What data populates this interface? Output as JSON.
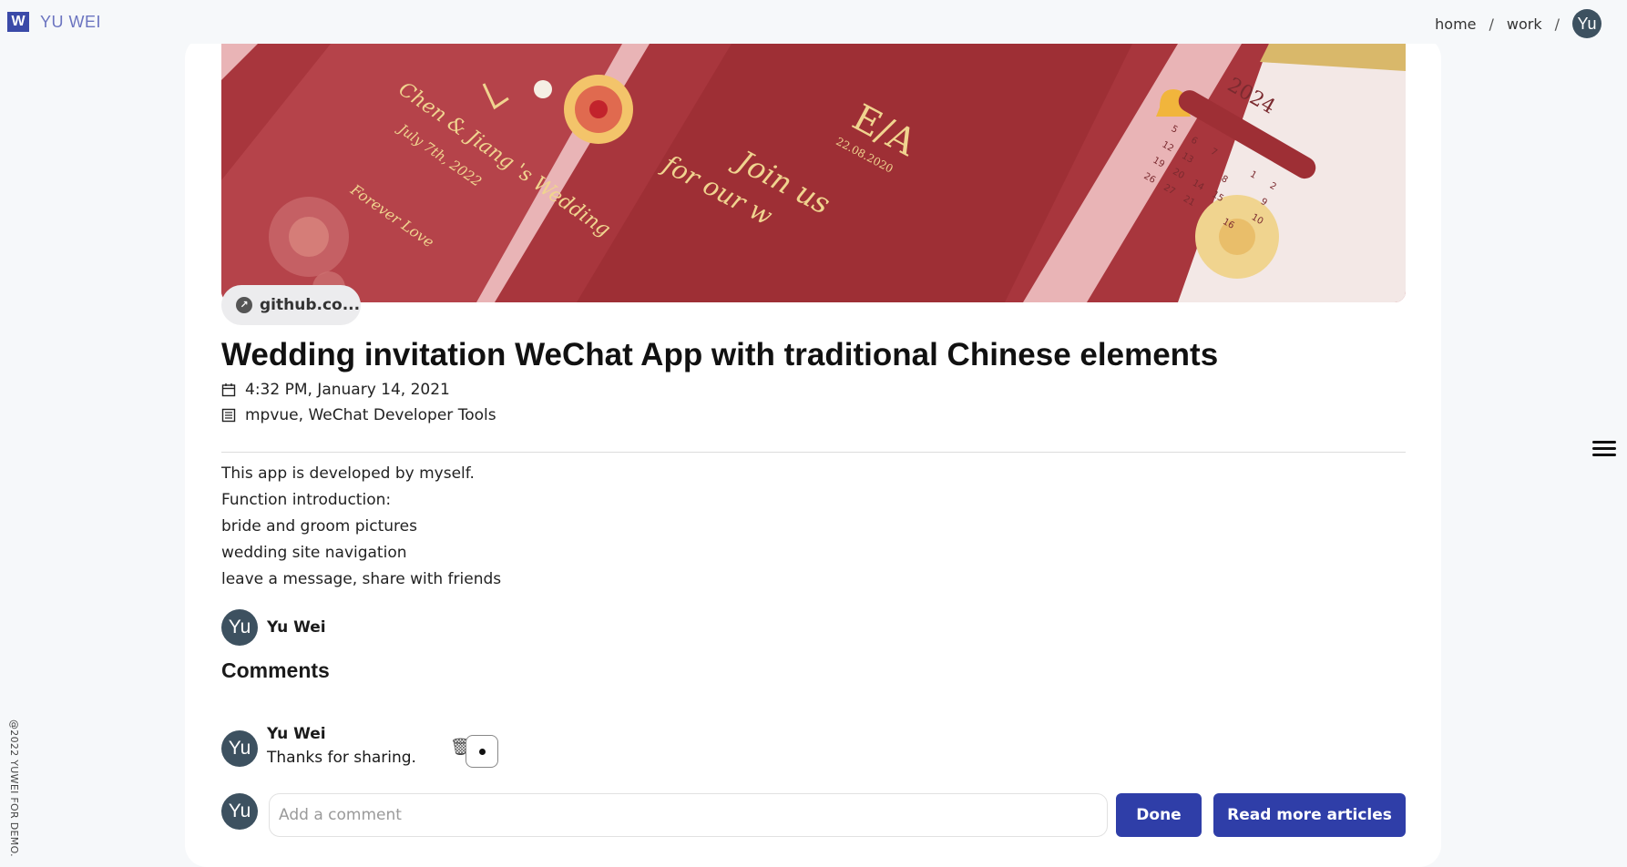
{
  "brand": {
    "logo_letter": "W",
    "name": "YU WEI"
  },
  "nav": {
    "home": "home",
    "sep": "/",
    "work": "work",
    "user_initials": "Yu"
  },
  "project": {
    "link_chip": "github.co...",
    "title": "Wedding invitation WeChat App with traditional Chinese elements",
    "date": "4:32 PM, January 14, 2021",
    "tech": "mpvue, WeChat Developer Tools",
    "description": [
      "This app is developed by myself.",
      "Function introduction:",
      "bride and groom pictures",
      "wedding site navigation",
      "leave a message, share with friends"
    ],
    "hero": {
      "card1_text": [
        "Chen & Jiang 's Wedding",
        "July 7th, 2022",
        "Forever Love"
      ],
      "card2_monogram": "E/A",
      "card2_date": "22.08.2020",
      "card2_tagline": "Join us",
      "card2_tagline2": "for our w",
      "calendar_year": "2024"
    }
  },
  "author": {
    "initials": "Yu",
    "name": "Yu Wei"
  },
  "comments": {
    "heading": "Comments",
    "items": [
      {
        "initials": "Yu",
        "author": "Yu Wei",
        "text": "Thanks for sharing."
      }
    ],
    "input_placeholder": "Add a comment",
    "done_label": "Done",
    "read_more_label": "Read more articles"
  },
  "footer": {
    "copyright": "@2022 YUWEI FOR DEMO."
  },
  "colors": {
    "accent": "#2f3ea8",
    "avatar": "#3d5160",
    "hero_red": "#a8363d",
    "gold": "#e8c67a"
  }
}
